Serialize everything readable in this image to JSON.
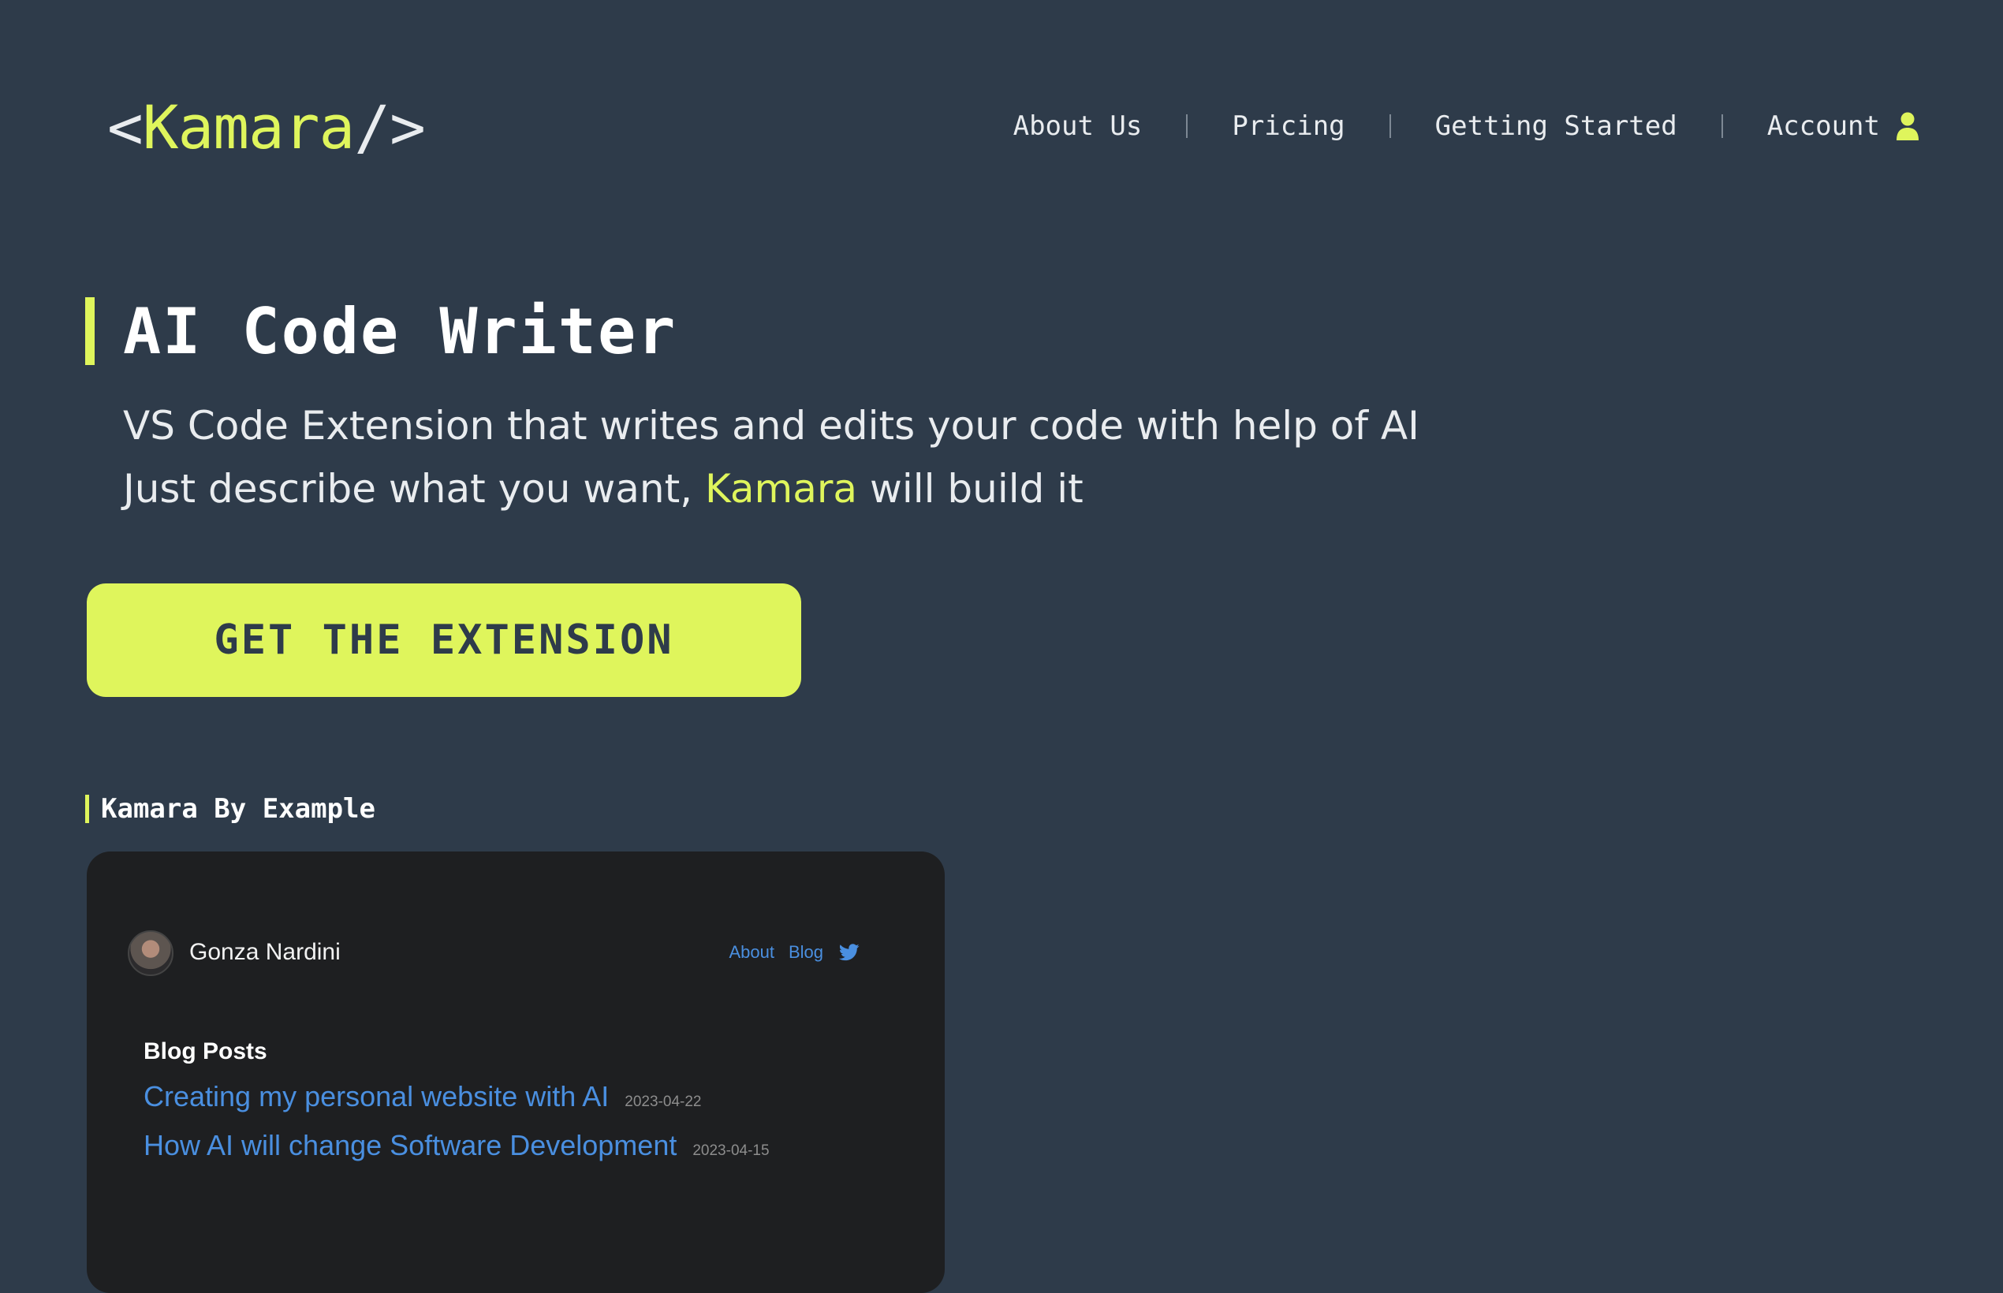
{
  "logo": {
    "prefix": "<",
    "name": "Kamara",
    "suffix": "/>"
  },
  "nav": {
    "items": [
      {
        "label": "About Us"
      },
      {
        "label": "Pricing"
      },
      {
        "label": "Getting Started"
      },
      {
        "label": "Account"
      }
    ]
  },
  "hero": {
    "title": "AI Code Writer",
    "line1": "VS Code Extension that writes and edits your code with help of AI",
    "line2_before": "Just describe what you want, ",
    "line2_accent": "Kamara",
    "line2_after": " will build it",
    "cta_label": "GET THE EXTENSION"
  },
  "example": {
    "section_title": "Kamara By Example",
    "card": {
      "author": "Gonza Nardini",
      "nav_about": "About",
      "nav_blog": "Blog",
      "heading": "Blog Posts",
      "posts": [
        {
          "title": "Creating my personal website with AI",
          "date": "2023-04-22"
        },
        {
          "title": "How AI will change Software Development",
          "date": "2023-04-15"
        }
      ]
    }
  },
  "colors": {
    "background": "#2e3b4a",
    "accent": "#dff55c",
    "card_background": "#1e1f21",
    "link": "#4a8fe0"
  },
  "icons": {
    "account": "user-icon",
    "twitter": "twitter-icon"
  }
}
